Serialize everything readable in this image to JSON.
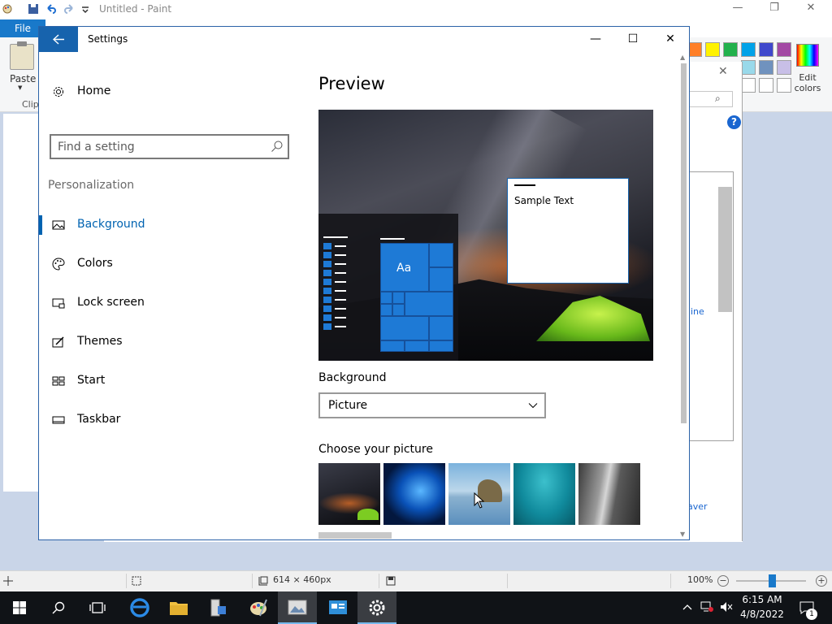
{
  "paint": {
    "title": "Untitled - Paint",
    "file_tab": "File",
    "paste_label": "Paste",
    "clipboard_label": "Clip",
    "edit_colors_label": "Edit colors",
    "palette_colors": [
      "#ff7f27",
      "#fff200",
      "#22b14c",
      "#00a2e8",
      "#3f48cc",
      "#a349a4",
      "#99d9ea",
      "#7092be",
      "#c8bfe7"
    ],
    "dialog_link": "ine",
    "dialog_saver": "aver",
    "dialog_help": "?",
    "status": {
      "dimensions": "614 × 460px",
      "zoom": "100%"
    }
  },
  "settings": {
    "title": "Settings",
    "home_label": "Home",
    "search_placeholder": "Find a setting",
    "section_label": "Personalization",
    "nav_items": [
      {
        "label": "Background",
        "icon": "picture-icon"
      },
      {
        "label": "Colors",
        "icon": "palette-icon"
      },
      {
        "label": "Lock screen",
        "icon": "lock-screen-icon"
      },
      {
        "label": "Themes",
        "icon": "themes-icon"
      },
      {
        "label": "Start",
        "icon": "start-icon"
      },
      {
        "label": "Taskbar",
        "icon": "taskbar-icon"
      }
    ],
    "active_nav": "Background",
    "preview_heading": "Preview",
    "preview_tile_text": "Aa",
    "preview_sample_text": "Sample Text",
    "background_label": "Background",
    "background_value": "Picture",
    "choose_picture_label": "Choose your picture",
    "accent_color": "#0063b1"
  },
  "taskbar": {
    "time": "6:15 AM",
    "date": "4/8/2022",
    "notification_count": "1",
    "pinned": [
      "start-icon",
      "search-icon",
      "task-view-icon",
      "edge-icon",
      "file-explorer-icon",
      "server-manager-icon",
      "paint-icon",
      "photo-viewer-icon",
      "control-panel-icon",
      "settings-gear-icon"
    ]
  }
}
